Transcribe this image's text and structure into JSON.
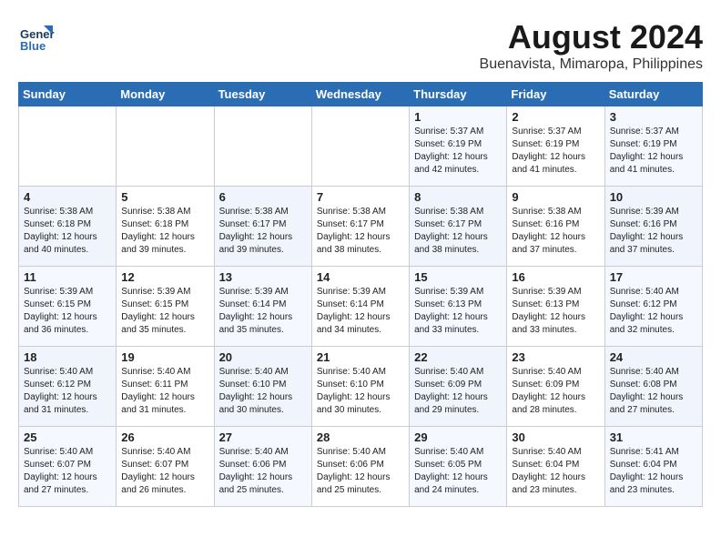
{
  "header": {
    "logo_line1": "General",
    "logo_line2": "Blue",
    "month_year": "August 2024",
    "location": "Buenavista, Mimaropa, Philippines"
  },
  "weekdays": [
    "Sunday",
    "Monday",
    "Tuesday",
    "Wednesday",
    "Thursday",
    "Friday",
    "Saturday"
  ],
  "weeks": [
    [
      {
        "day": "",
        "info": ""
      },
      {
        "day": "",
        "info": ""
      },
      {
        "day": "",
        "info": ""
      },
      {
        "day": "",
        "info": ""
      },
      {
        "day": "1",
        "info": "Sunrise: 5:37 AM\nSunset: 6:19 PM\nDaylight: 12 hours\nand 42 minutes."
      },
      {
        "day": "2",
        "info": "Sunrise: 5:37 AM\nSunset: 6:19 PM\nDaylight: 12 hours\nand 41 minutes."
      },
      {
        "day": "3",
        "info": "Sunrise: 5:37 AM\nSunset: 6:19 PM\nDaylight: 12 hours\nand 41 minutes."
      }
    ],
    [
      {
        "day": "4",
        "info": "Sunrise: 5:38 AM\nSunset: 6:18 PM\nDaylight: 12 hours\nand 40 minutes."
      },
      {
        "day": "5",
        "info": "Sunrise: 5:38 AM\nSunset: 6:18 PM\nDaylight: 12 hours\nand 39 minutes."
      },
      {
        "day": "6",
        "info": "Sunrise: 5:38 AM\nSunset: 6:17 PM\nDaylight: 12 hours\nand 39 minutes."
      },
      {
        "day": "7",
        "info": "Sunrise: 5:38 AM\nSunset: 6:17 PM\nDaylight: 12 hours\nand 38 minutes."
      },
      {
        "day": "8",
        "info": "Sunrise: 5:38 AM\nSunset: 6:17 PM\nDaylight: 12 hours\nand 38 minutes."
      },
      {
        "day": "9",
        "info": "Sunrise: 5:38 AM\nSunset: 6:16 PM\nDaylight: 12 hours\nand 37 minutes."
      },
      {
        "day": "10",
        "info": "Sunrise: 5:39 AM\nSunset: 6:16 PM\nDaylight: 12 hours\nand 37 minutes."
      }
    ],
    [
      {
        "day": "11",
        "info": "Sunrise: 5:39 AM\nSunset: 6:15 PM\nDaylight: 12 hours\nand 36 minutes."
      },
      {
        "day": "12",
        "info": "Sunrise: 5:39 AM\nSunset: 6:15 PM\nDaylight: 12 hours\nand 35 minutes."
      },
      {
        "day": "13",
        "info": "Sunrise: 5:39 AM\nSunset: 6:14 PM\nDaylight: 12 hours\nand 35 minutes."
      },
      {
        "day": "14",
        "info": "Sunrise: 5:39 AM\nSunset: 6:14 PM\nDaylight: 12 hours\nand 34 minutes."
      },
      {
        "day": "15",
        "info": "Sunrise: 5:39 AM\nSunset: 6:13 PM\nDaylight: 12 hours\nand 33 minutes."
      },
      {
        "day": "16",
        "info": "Sunrise: 5:39 AM\nSunset: 6:13 PM\nDaylight: 12 hours\nand 33 minutes."
      },
      {
        "day": "17",
        "info": "Sunrise: 5:40 AM\nSunset: 6:12 PM\nDaylight: 12 hours\nand 32 minutes."
      }
    ],
    [
      {
        "day": "18",
        "info": "Sunrise: 5:40 AM\nSunset: 6:12 PM\nDaylight: 12 hours\nand 31 minutes."
      },
      {
        "day": "19",
        "info": "Sunrise: 5:40 AM\nSunset: 6:11 PM\nDaylight: 12 hours\nand 31 minutes."
      },
      {
        "day": "20",
        "info": "Sunrise: 5:40 AM\nSunset: 6:10 PM\nDaylight: 12 hours\nand 30 minutes."
      },
      {
        "day": "21",
        "info": "Sunrise: 5:40 AM\nSunset: 6:10 PM\nDaylight: 12 hours\nand 30 minutes."
      },
      {
        "day": "22",
        "info": "Sunrise: 5:40 AM\nSunset: 6:09 PM\nDaylight: 12 hours\nand 29 minutes."
      },
      {
        "day": "23",
        "info": "Sunrise: 5:40 AM\nSunset: 6:09 PM\nDaylight: 12 hours\nand 28 minutes."
      },
      {
        "day": "24",
        "info": "Sunrise: 5:40 AM\nSunset: 6:08 PM\nDaylight: 12 hours\nand 27 minutes."
      }
    ],
    [
      {
        "day": "25",
        "info": "Sunrise: 5:40 AM\nSunset: 6:07 PM\nDaylight: 12 hours\nand 27 minutes."
      },
      {
        "day": "26",
        "info": "Sunrise: 5:40 AM\nSunset: 6:07 PM\nDaylight: 12 hours\nand 26 minutes."
      },
      {
        "day": "27",
        "info": "Sunrise: 5:40 AM\nSunset: 6:06 PM\nDaylight: 12 hours\nand 25 minutes."
      },
      {
        "day": "28",
        "info": "Sunrise: 5:40 AM\nSunset: 6:06 PM\nDaylight: 12 hours\nand 25 minutes."
      },
      {
        "day": "29",
        "info": "Sunrise: 5:40 AM\nSunset: 6:05 PM\nDaylight: 12 hours\nand 24 minutes."
      },
      {
        "day": "30",
        "info": "Sunrise: 5:40 AM\nSunset: 6:04 PM\nDaylight: 12 hours\nand 23 minutes."
      },
      {
        "day": "31",
        "info": "Sunrise: 5:41 AM\nSunset: 6:04 PM\nDaylight: 12 hours\nand 23 minutes."
      }
    ]
  ]
}
